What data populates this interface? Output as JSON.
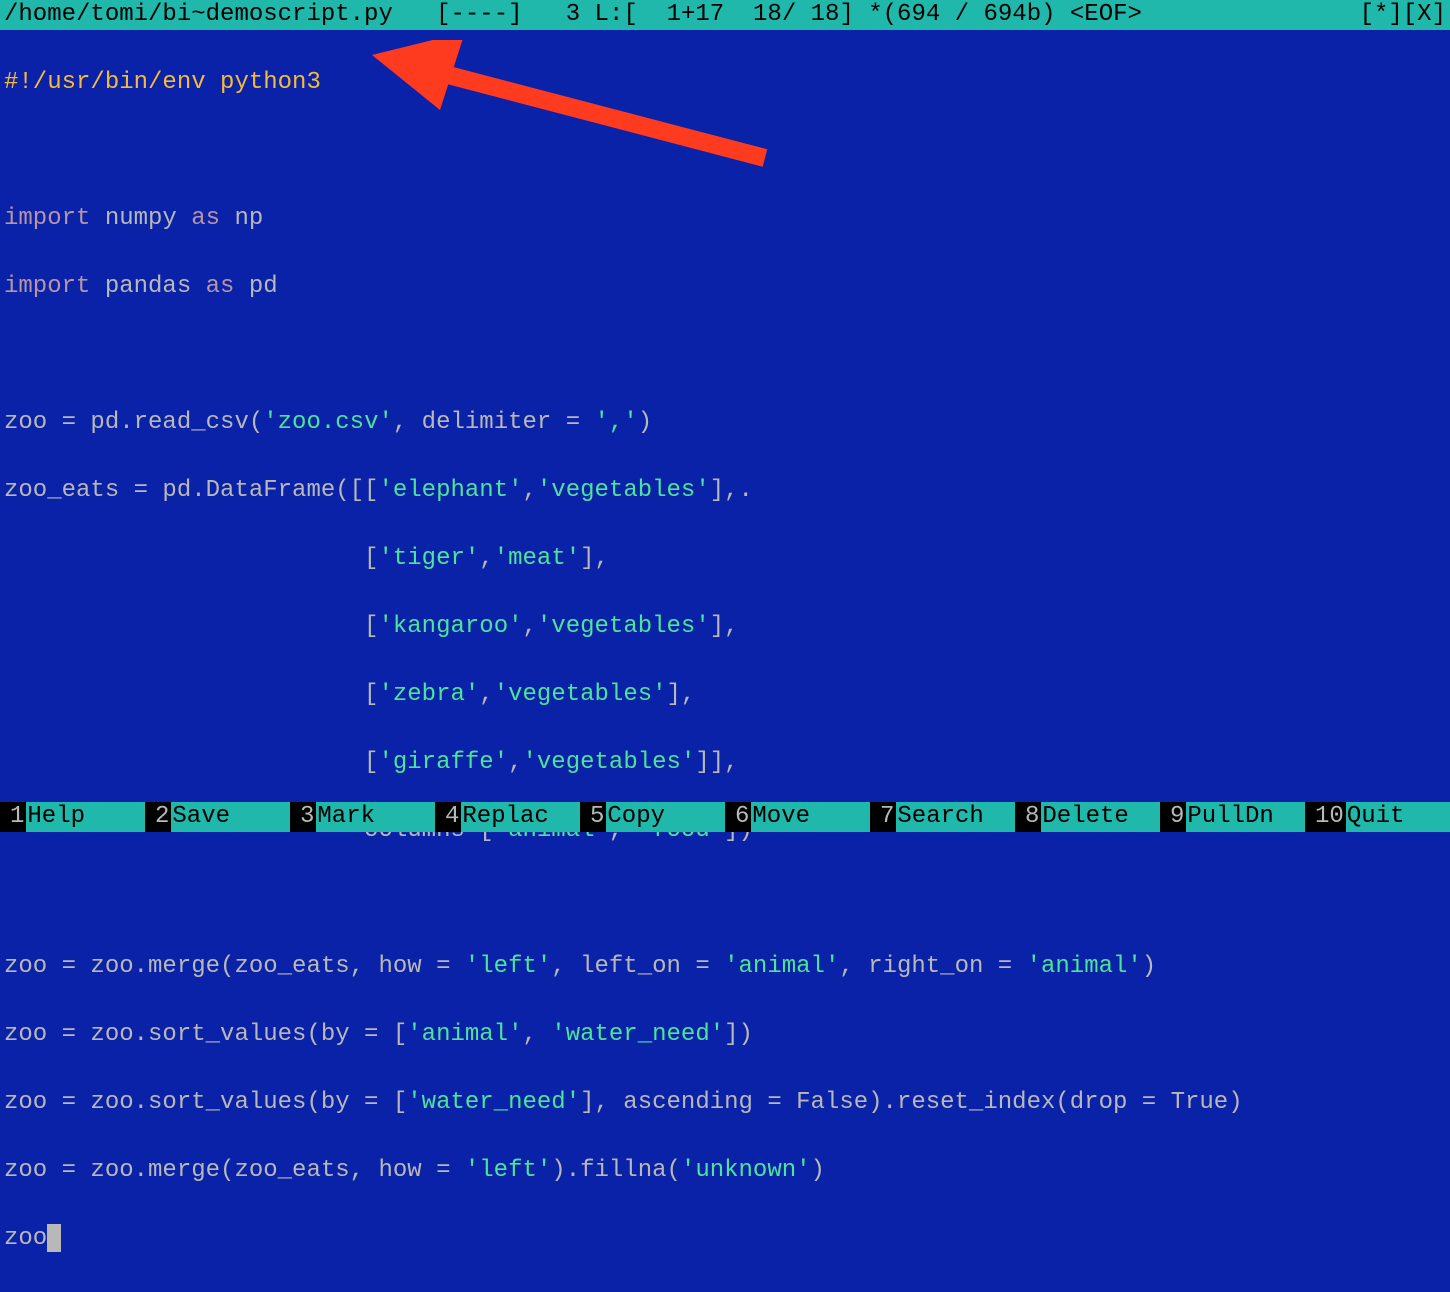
{
  "titlebar": {
    "path": "/home/tomi/bi~demoscript.py",
    "mode": "[----]",
    "col": "3",
    "line_prefix": "L:[",
    "line_offset": "1+17",
    "line_cur": "18",
    "line_total": "18",
    "bytes_cur": "694",
    "bytes_total": "694b",
    "eof": "<EOF>",
    "star": "[*]",
    "x": "[X]"
  },
  "code": {
    "l1": {
      "a": "#!/usr/bin/env python3"
    },
    "l2": "",
    "l3": {
      "a": "import",
      "b": " numpy ",
      "c": "as",
      "d": " np"
    },
    "l4": {
      "a": "import",
      "b": " pandas ",
      "c": "as",
      "d": " pd"
    },
    "l5": "",
    "l6": {
      "a": "zoo = pd.read_csv(",
      "b": "'zoo.csv'",
      "c": ", delimiter = ",
      "d": "','",
      "e": ")"
    },
    "l7": {
      "a": "zoo_eats = pd.DataFrame([[",
      "b": "'elephant'",
      "c": ",",
      "d": "'vegetables'",
      "e": "],."
    },
    "l8": {
      "a": "                         [",
      "b": "'tiger'",
      "c": ",",
      "d": "'meat'",
      "e": "],"
    },
    "l9": {
      "a": "                         [",
      "b": "'kangaroo'",
      "c": ",",
      "d": "'vegetables'",
      "e": "],"
    },
    "l10": {
      "a": "                         [",
      "b": "'zebra'",
      "c": ",",
      "d": "'vegetables'",
      "e": "],"
    },
    "l11": {
      "a": "                         [",
      "b": "'giraffe'",
      "c": ",",
      "d": "'vegetables'",
      "e": "]],"
    },
    "l12": {
      "a": "                         columns=[",
      "b": "'animal'",
      "c": ", ",
      "d": "'food'",
      "e": "])"
    },
    "l13": "",
    "l14": {
      "a": "zoo = zoo.merge(zoo_eats, how = ",
      "b": "'left'",
      "c": ", left_on = ",
      "d": "'animal'",
      "e": ", right_on = ",
      "f": "'animal'",
      "g": ")"
    },
    "l15": {
      "a": "zoo = zoo.sort_values(by = [",
      "b": "'animal'",
      "c": ", ",
      "d": "'water_need'",
      "e": "])"
    },
    "l16": {
      "a": "zoo = zoo.sort_values(by = [",
      "b": "'water_need'",
      "c": "], ascending = False).reset_index(drop = True)"
    },
    "l17": {
      "a": "zoo = zoo.merge(zoo_eats, how = ",
      "b": "'left'",
      "c": ").fillna(",
      "d": "'unknown'",
      "e": ")"
    },
    "l18": {
      "a": "zoo"
    }
  },
  "fnkeys": [
    {
      "num": "1",
      "label": "Help"
    },
    {
      "num": "2",
      "label": "Save"
    },
    {
      "num": "3",
      "label": "Mark"
    },
    {
      "num": "4",
      "label": "Replac"
    },
    {
      "num": "5",
      "label": "Copy"
    },
    {
      "num": "6",
      "label": "Move"
    },
    {
      "num": "7",
      "label": "Search"
    },
    {
      "num": "8",
      "label": "Delete"
    },
    {
      "num": "9",
      "label": "PullDn"
    },
    {
      "num": "10",
      "label": "Quit"
    }
  ]
}
